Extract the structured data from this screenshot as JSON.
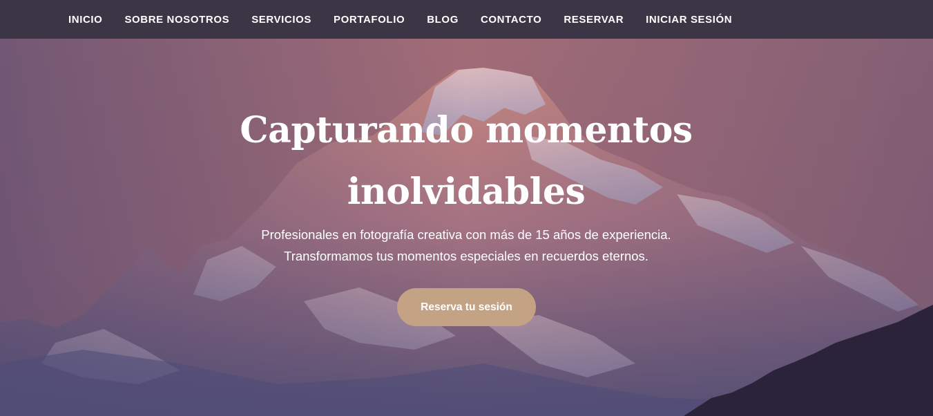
{
  "nav": {
    "items": [
      {
        "label": "INICIO"
      },
      {
        "label": "SOBRE NOSOTROS"
      },
      {
        "label": "SERVICIOS"
      },
      {
        "label": "PORTAFOLIO"
      },
      {
        "label": "BLOG"
      },
      {
        "label": "CONTACTO"
      },
      {
        "label": "RESERVAR"
      },
      {
        "label": "INICIAR SESIÓN"
      }
    ]
  },
  "hero": {
    "title_line1": "Capturando momentos",
    "title_line2": "inolvidables",
    "subtitle_line1": "Profesionales en fotografía creativa con más de 15 años de experiencia.",
    "subtitle_line2": "Transformamos tus momentos especiales en recuerdos eternos.",
    "cta_label": "Reserva tu sesión"
  },
  "colors": {
    "nav_bg": "#3c3545",
    "overlay": "#a36d78",
    "cta_bg": "#c4a384",
    "text": "#ffffff"
  }
}
